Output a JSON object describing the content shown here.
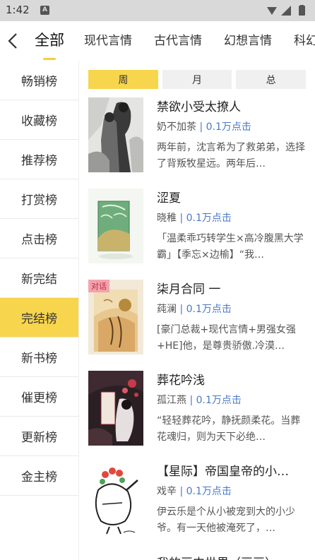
{
  "status": {
    "time": "1:42",
    "notif_icon": "A"
  },
  "tabs": [
    "全部",
    "现代言情",
    "古代言情",
    "幻想言情",
    "科幻"
  ],
  "active_tab": 0,
  "sidebar": {
    "items": [
      "畅销榜",
      "收藏榜",
      "推荐榜",
      "打赏榜",
      "点击榜",
      "新完结",
      "完结榜",
      "新书榜",
      "催更榜",
      "更新榜",
      "金主榜"
    ],
    "active_index": 6
  },
  "periods": {
    "items": [
      "周",
      "月",
      "总"
    ],
    "active_index": 0
  },
  "colors": {
    "accent": "#f7d54c",
    "link": "#4a78c8"
  },
  "books": [
    {
      "title": "禁欲小受太撩人",
      "author": "奶不加茶",
      "separator": "|",
      "hits": "0.1万点击",
      "desc": "两年前，沈言希为了救弟弟，选择了背叛牧星远。两年后…",
      "tag": ""
    },
    {
      "title": "涩夏",
      "author": "晓稚",
      "separator": "|",
      "hits": "0.1万点击",
      "desc": "「温柔乖巧转学生×高冷腹黑大学霸」【季忘×边榆】“我…",
      "tag": ""
    },
    {
      "title": "柒月合同 一",
      "author": "莼澜",
      "separator": "|",
      "hits": "0.1万点击",
      "desc": "[豪门总裁+现代言情+男强女强+HE]他，是尊贵骄傲.冷漠…",
      "tag": "对话"
    },
    {
      "title": "葬花吟浅",
      "author": "孤江燕",
      "separator": "|",
      "hits": "0.1万点击",
      "desc": "“轻轻葬花吟，静抚颜柔花。当葬花魂归，则为天下必绝…",
      "tag": ""
    },
    {
      "title": "【星际】帝国皇帝的小…",
      "author": "戏辛",
      "separator": "|",
      "hits": "0.1万点击",
      "desc": "伊云乐是个从小被宠到大的小少爷。有一天他被淹死了，…",
      "tag": ""
    },
    {
      "title": "我的画中世界（画画）",
      "author": "",
      "separator": "",
      "hits": "",
      "desc": "",
      "tag": ""
    }
  ]
}
